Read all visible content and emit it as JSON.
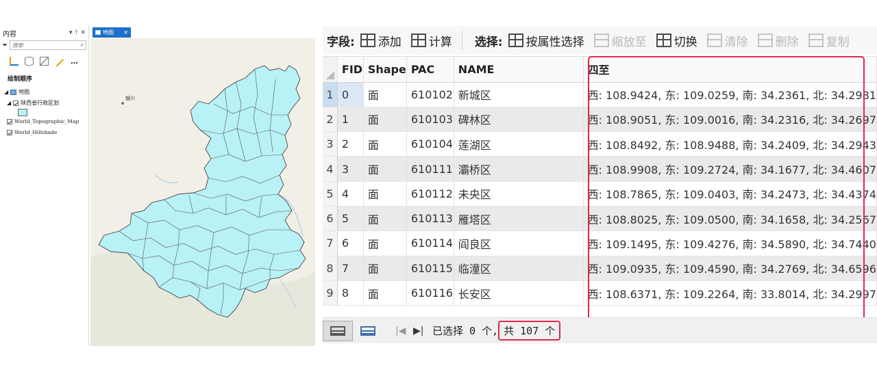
{
  "contents_pane": {
    "title": "内容",
    "search_placeholder": "搜索",
    "draw_order_label": "绘制顺序",
    "layers": {
      "map": "地图",
      "boundary": "陕西省行政区划",
      "topo": "World_Topographic_Map",
      "hillshade": "World_Hillshade"
    }
  },
  "map_view": {
    "tab_label": "地图",
    "labels": {
      "yinchuan": "银川"
    },
    "fill_color": "#b8f1f6",
    "outline_color": "#444444"
  },
  "toolbar": {
    "field_label": "字段:",
    "add": "添加",
    "calculate": "计算",
    "select_label": "选择:",
    "select_by_attr": "按属性选择",
    "zoom_to": "缩放至",
    "switch": "切换",
    "clear": "清除",
    "delete": "删除",
    "copy": "复制"
  },
  "table": {
    "columns": [
      "FID",
      "Shape",
      "PAC",
      "NAME",
      "四至"
    ],
    "rows": [
      {
        "num": "1",
        "fid": "0",
        "shape": "面",
        "pac": "610102",
        "name": "新城区",
        "extent": "西: 108.9424, 东: 109.0259, 南: 34.2361, 北: 34.2981"
      },
      {
        "num": "2",
        "fid": "1",
        "shape": "面",
        "pac": "610103",
        "name": "碑林区",
        "extent": "西: 108.9051, 东: 109.0016, 南: 34.2316, 北: 34.2697"
      },
      {
        "num": "3",
        "fid": "2",
        "shape": "面",
        "pac": "610104",
        "name": "莲湖区",
        "extent": "西: 108.8492, 东: 108.9488, 南: 34.2409, 北: 34.2943"
      },
      {
        "num": "4",
        "fid": "3",
        "shape": "面",
        "pac": "610111",
        "name": "灞桥区",
        "extent": "西: 108.9908, 东: 109.2724, 南: 34.1677, 北: 34.4607"
      },
      {
        "num": "5",
        "fid": "4",
        "shape": "面",
        "pac": "610112",
        "name": "未央区",
        "extent": "西: 108.7865, 东: 109.0403, 南: 34.2473, 北: 34.4374"
      },
      {
        "num": "6",
        "fid": "5",
        "shape": "面",
        "pac": "610113",
        "name": "雁塔区",
        "extent": "西: 108.8025, 东: 109.0500, 南: 34.1658, 北: 34.2567"
      },
      {
        "num": "7",
        "fid": "6",
        "shape": "面",
        "pac": "610114",
        "name": "阎良区",
        "extent": "西: 109.1495, 东: 109.4276, 南: 34.5890, 北: 34.7440"
      },
      {
        "num": "8",
        "fid": "7",
        "shape": "面",
        "pac": "610115",
        "name": "临潼区",
        "extent": "西: 109.0935, 东: 109.4590, 南: 34.2769, 北: 34.6596"
      },
      {
        "num": "9",
        "fid": "8",
        "shape": "面",
        "pac": "610116",
        "name": "长安区",
        "extent": "西: 108.6371, 东: 109.2264, 南: 33.8014, 北: 34.2997"
      }
    ]
  },
  "status": {
    "selected": "已选择 0 个,",
    "total": "共 107 个"
  },
  "colors": {
    "highlight_red": "#e0284a",
    "tab_blue": "#1f6fc8",
    "selected_row": "#c9dcf0"
  }
}
